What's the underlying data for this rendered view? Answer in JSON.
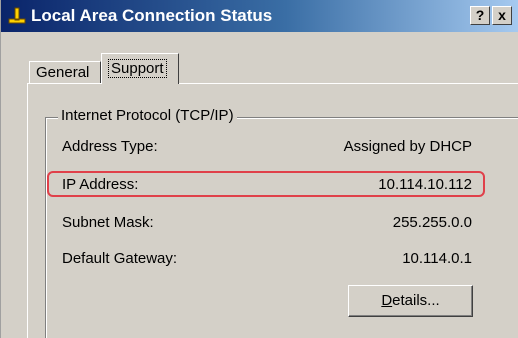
{
  "window": {
    "title": "Local Area Connection Status",
    "help_button": "?",
    "close_button": "x",
    "icon": "network-connection-icon"
  },
  "tabs": [
    {
      "label": "General",
      "selected": false
    },
    {
      "label": "Support",
      "selected": true
    }
  ],
  "group": {
    "label": "Internet Protocol (TCP/IP)",
    "rows": [
      {
        "label": "Address Type:",
        "value": "Assigned by DHCP"
      },
      {
        "label": "IP Address:",
        "value": "10.114.10.112",
        "highlighted": true
      },
      {
        "label": "Subnet Mask:",
        "value": "255.255.0.0"
      },
      {
        "label": "Default Gateway:",
        "value": "10.114.0.1"
      }
    ]
  },
  "details_button": {
    "mnemonic": "D",
    "rest": "etails..."
  },
  "colors": {
    "titlebar_start": "#0a246a",
    "titlebar_end": "#a6caf0",
    "highlight": "#e0404a",
    "face": "#d4d0c8"
  }
}
